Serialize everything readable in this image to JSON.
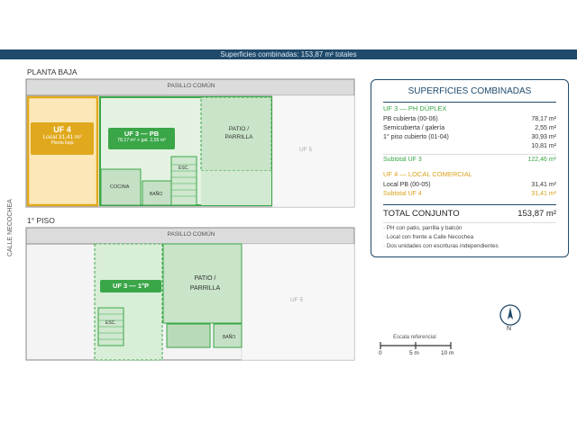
{
  "header": {
    "title": "Superficies combinadas: 153,87 m² totales"
  },
  "planta_baja": {
    "label": "PLANTA BAJA",
    "pasillo": "PASILLO COMÚN",
    "uf4": {
      "title": "UF 4",
      "area": "Local 31,41 m²",
      "sub": "Planta baja"
    },
    "uf3": {
      "title": "UF 3 — PB",
      "area": "78,17 m² + gal. 2,55 m²"
    },
    "patio": "PATIO / PARRILLA",
    "uf5": "UF 5",
    "esc": "ESC.",
    "cocina": "COCINA",
    "bano": "BAÑO"
  },
  "piso1": {
    "label": "1° PISO",
    "pasillo": "PASILLO COMÚN",
    "uf3": "UF 3 — 1°P",
    "patio": "PATIO / PARRILLA",
    "uf5": "UF 5",
    "esc": "ESC.",
    "bano": "BAÑO"
  },
  "street": "CALLE NECOCHEA",
  "summary": {
    "title": "SUPERFICIES COMBINADAS",
    "uf3_title": "UF 3 — PH DÚPLEX",
    "uf3_rows": [
      {
        "label": "PB cubierta (00-06)",
        "value": "78,17 m²"
      },
      {
        "label": "Semicubierta / galería",
        "value": "2,55 m²"
      },
      {
        "label": "1° piso cubierto (01-04)",
        "value": "30,93 m²"
      },
      {
        "label": "",
        "value": "10,81 m²"
      }
    ],
    "uf3_subtotal": {
      "label": "Subtotal UF 3",
      "value": "122,46 m²"
    },
    "uf4_title": "UF 4 — LOCAL COMERCIAL",
    "uf4_rows": [
      {
        "label": "Local PB (00-05)",
        "value": "31,41 m²"
      }
    ],
    "uf4_subtotal": {
      "label": "Subtotal UF 4",
      "value": "31,41 m²"
    },
    "total": {
      "label": "TOTAL CONJUNTO",
      "value": "153,87 m²"
    },
    "notes": [
      "· PH con patio, parrilla y balcón",
      "· Local con frente a Calle Necochea",
      "· Dos unidades con escrituras independientes"
    ]
  },
  "compass": {
    "n": "N"
  },
  "scale": {
    "title": "Escala referencial",
    "ticks": [
      "0",
      "5 m",
      "10 m"
    ]
  },
  "colors": {
    "navy": "#1f4a6b",
    "green": "#3aa648",
    "yellow": "#f2c230",
    "light_green": "#cfe8cf"
  }
}
